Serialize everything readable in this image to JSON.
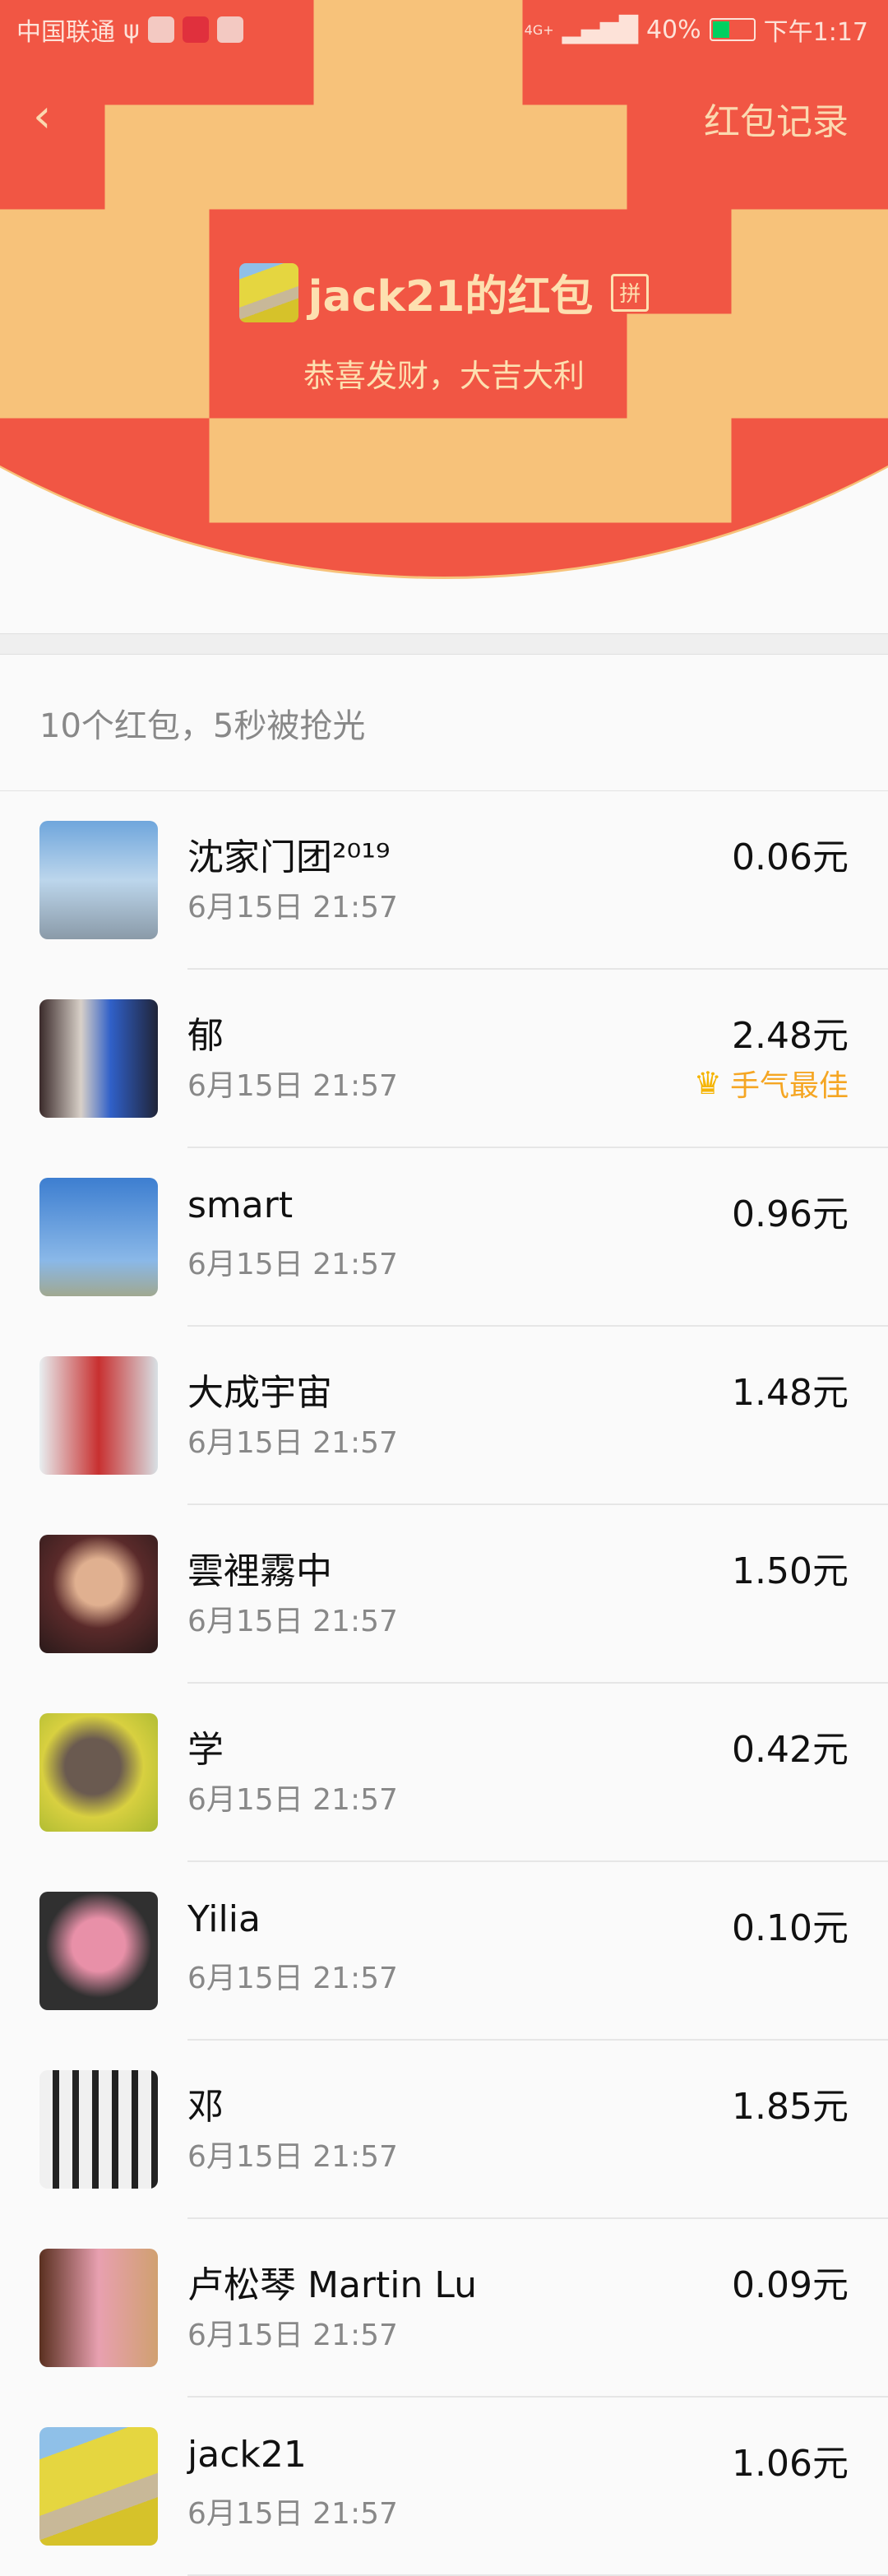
{
  "status_bar": {
    "carrier": "中国联通",
    "network": "4G+",
    "battery": "40%",
    "battery_level": 0.4,
    "time": "下午1:17"
  },
  "nav": {
    "back_icon": "chevron-left-icon",
    "records_label": "红包记录"
  },
  "sender": {
    "name": "jack21的红包",
    "pin_badge": "拼",
    "wish": "恭喜发财，大吉大利"
  },
  "summary": "10个红包，5秒被抢光",
  "colors": {
    "header_red": "#f15644",
    "header_text": "#fde0b0",
    "best_luck": "#f5a623"
  },
  "entries": [
    {
      "name": "沈家门团²⁰¹⁹",
      "time": "6月15日  21:57",
      "amount": "0.06元",
      "avatar": "linear-gradient(#6fa6dc,#bcd6ec 50%,#8a9aa8)"
    },
    {
      "name": "郁",
      "time": "6月15日  21:57",
      "amount": "2.48元",
      "best": "手气最佳",
      "avatar": "linear-gradient(90deg,#3a2a2a,#d8d0c8 35%,#3060c8 60%,#202438)"
    },
    {
      "name": "smart",
      "time": "6月15日  21:57",
      "amount": "0.96元",
      "avatar": "linear-gradient(#3d7ed0,#8ab8e8 70%,#a0a890)"
    },
    {
      "name": "大成宇宙",
      "time": "6月15日  21:57",
      "amount": "1.48元",
      "avatar": "linear-gradient(90deg,#e8eef0,#c83030 50%,#d8e0e4)"
    },
    {
      "name": "雲裡霧中",
      "time": "6月15日  21:57",
      "amount": "1.50元",
      "avatar": "radial-gradient(circle at 50% 40%,#e0b090 25%,#5a2a2a 50%,#2a1a1a)"
    },
    {
      "name": "学",
      "time": "6月15日  21:57",
      "amount": "0.42元",
      "avatar": "radial-gradient(circle at 45% 45%,#6a5a50 30%,#d8d040 55%,#a8b830)"
    },
    {
      "name": "Yilia",
      "time": "6月15日  21:57",
      "amount": "0.10元",
      "avatar": "radial-gradient(circle at 50% 45%,#e890a8 30%,#303030 60%)"
    },
    {
      "name": "邓",
      "time": "6月15日  21:57",
      "amount": "1.85元",
      "avatar": "repeating-linear-gradient(90deg,#f0f0f0 0 16px,#222 16px 24px)"
    },
    {
      "name": "卢松琴 Martin Lu",
      "time": "6月15日  21:57",
      "amount": "0.09元",
      "avatar": "linear-gradient(90deg,#5a3020,#e8a0b0 50%,#d0a070)"
    },
    {
      "name": "jack21",
      "time": "6月15日  21:57",
      "amount": "1.06元",
      "avatar": "linear-gradient(160deg,#8fc0e8 0 20%,#e5d640 20% 55%,#c8b898 55% 70%,#d6c22a 70%)"
    }
  ]
}
